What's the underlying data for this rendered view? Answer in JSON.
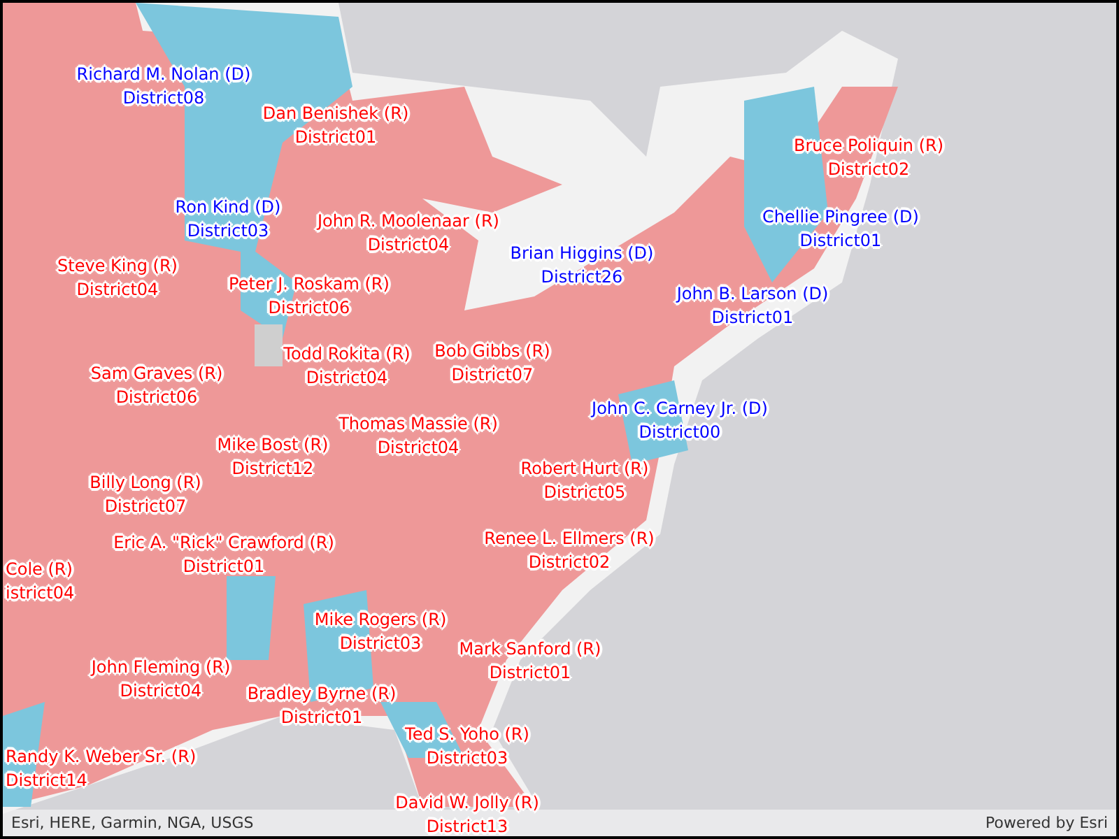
{
  "map_labels": [
    {
      "name": "Richard M. Nolan (D)",
      "district": "District08",
      "color": "#0000ff"
    },
    {
      "name": "Dan Benishek (R)",
      "district": "District01",
      "color": "#ff0000"
    },
    {
      "name": "Ron Kind (D)",
      "district": "District03",
      "color": "#0000ff"
    },
    {
      "name": "John R. Moolenaar (R)",
      "district": "District04",
      "color": "#ff0000"
    },
    {
      "name": "Brian Higgins (D)",
      "district": "District26",
      "color": "#0000ff"
    },
    {
      "name": "Steve King (R)",
      "district": "District04",
      "color": "#ff0000"
    },
    {
      "name": "Peter J. Roskam (R)",
      "district": "District06",
      "color": "#ff0000"
    },
    {
      "name": "Bruce Poliquin (R)",
      "district": "District02",
      "color": "#ff0000"
    },
    {
      "name": "Chellie Pingree (D)",
      "district": "District01",
      "color": "#0000ff"
    },
    {
      "name": "John B. Larson (D)",
      "district": "District01",
      "color": "#0000ff"
    },
    {
      "name": "Todd Rokita (R)",
      "district": "District04",
      "color": "#ff0000"
    },
    {
      "name": "Bob Gibbs (R)",
      "district": "District07",
      "color": "#ff0000"
    },
    {
      "name": "Sam Graves (R)",
      "district": "District06",
      "color": "#ff0000"
    },
    {
      "name": "John C. Carney Jr. (D)",
      "district": "District00",
      "color": "#0000ff"
    },
    {
      "name": "Thomas Massie (R)",
      "district": "District04",
      "color": "#ff0000"
    },
    {
      "name": "Mike Bost (R)",
      "district": "District12",
      "color": "#ff0000"
    },
    {
      "name": "Robert Hurt (R)",
      "district": "District05",
      "color": "#ff0000"
    },
    {
      "name": "Billy Long (R)",
      "district": "District07",
      "color": "#ff0000"
    },
    {
      "name": "Eric A. \"Rick\" Crawford (R)",
      "district": "District01",
      "color": "#ff0000"
    },
    {
      "name": "Renee L. Ellmers (R)",
      "district": "District02",
      "color": "#ff0000"
    },
    {
      "name": "Cole (R)",
      "district": "istrict04",
      "color": "#ff0000"
    },
    {
      "name": "Mike Rogers (R)",
      "district": "District03",
      "color": "#ff0000"
    },
    {
      "name": "Mark Sanford (R)",
      "district": "District01",
      "color": "#ff0000"
    },
    {
      "name": "John Fleming (R)",
      "district": "District04",
      "color": "#ff0000"
    },
    {
      "name": "Bradley Byrne (R)",
      "district": "District01",
      "color": "#ff0000"
    },
    {
      "name": "Ted S. Yoho (R)",
      "district": "District03",
      "color": "#ff0000"
    },
    {
      "name": "Randy K. Weber Sr. (R)",
      "district": "District14",
      "color": "#ff0000"
    },
    {
      "name": "David W. Jolly (R)",
      "district": "District13",
      "color": "#ff0000"
    }
  ],
  "attribution": {
    "sources": "Esri, HERE, Garmin, NGA, USGS",
    "powered_by": "Powered by Esri"
  }
}
